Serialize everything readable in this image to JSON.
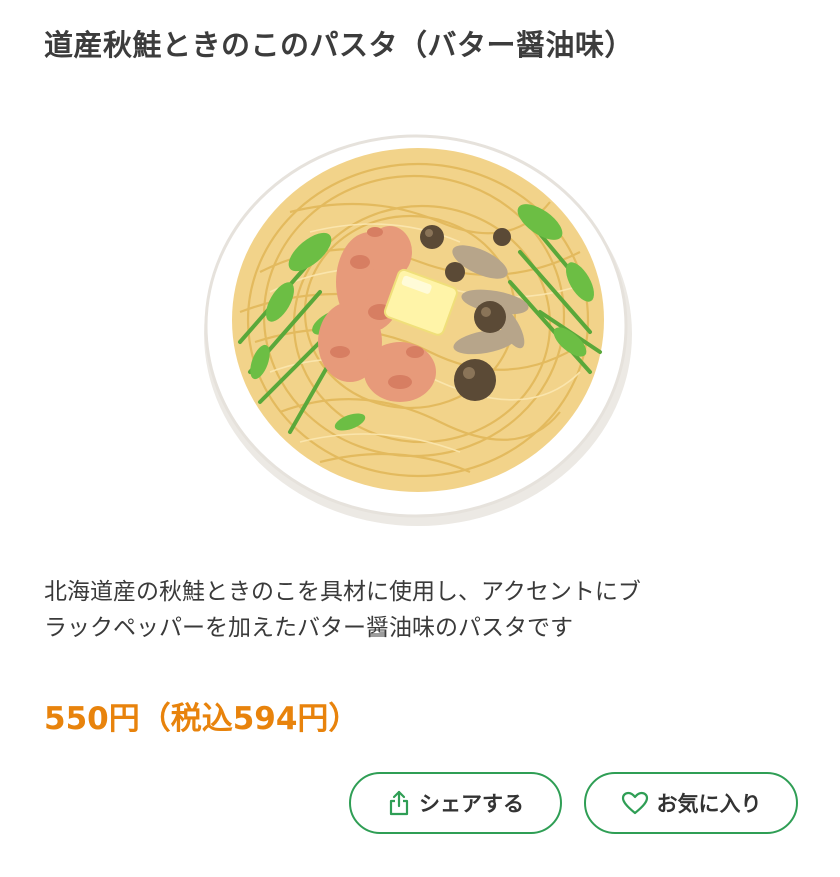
{
  "product": {
    "title": "道産秋鮭ときのこのパスタ（バター醤油味）",
    "description_lines": [
      "北海道産の秋鮭ときのこを具材に使用し、アクセントにブ",
      "ラックペッパーを加えたバター醤油味のパスタです"
    ],
    "price": "550円（税込594円）"
  },
  "actions": {
    "share_label": "シェアする",
    "favorite_label": "お気に入り"
  },
  "colors": {
    "price": "#e8830c",
    "accent_green": "#2f9e55"
  },
  "icons": {
    "share": "share-icon",
    "favorite": "heart-icon"
  }
}
